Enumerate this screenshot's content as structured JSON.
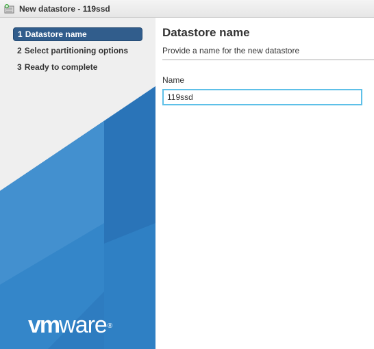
{
  "window": {
    "title": "New datastore - 119ssd",
    "icon": "new-datastore-icon"
  },
  "wizard": {
    "active_step": 0,
    "steps": [
      {
        "number": "1",
        "label": "Datastore name"
      },
      {
        "number": "2",
        "label": "Select partitioning options"
      },
      {
        "number": "3",
        "label": "Ready to complete"
      }
    ],
    "logo": {
      "vm": "vm",
      "ware": "ware",
      "registered": "®"
    }
  },
  "main": {
    "title": "Datastore name",
    "subtitle": "Provide a name for the new datastore",
    "name_label": "Name",
    "name_value": "119ssd"
  },
  "colors": {
    "active_step_bg": "#315d8c",
    "input_focus_border": "#5ec0e8",
    "brand_blue": "#2a7cc0"
  }
}
